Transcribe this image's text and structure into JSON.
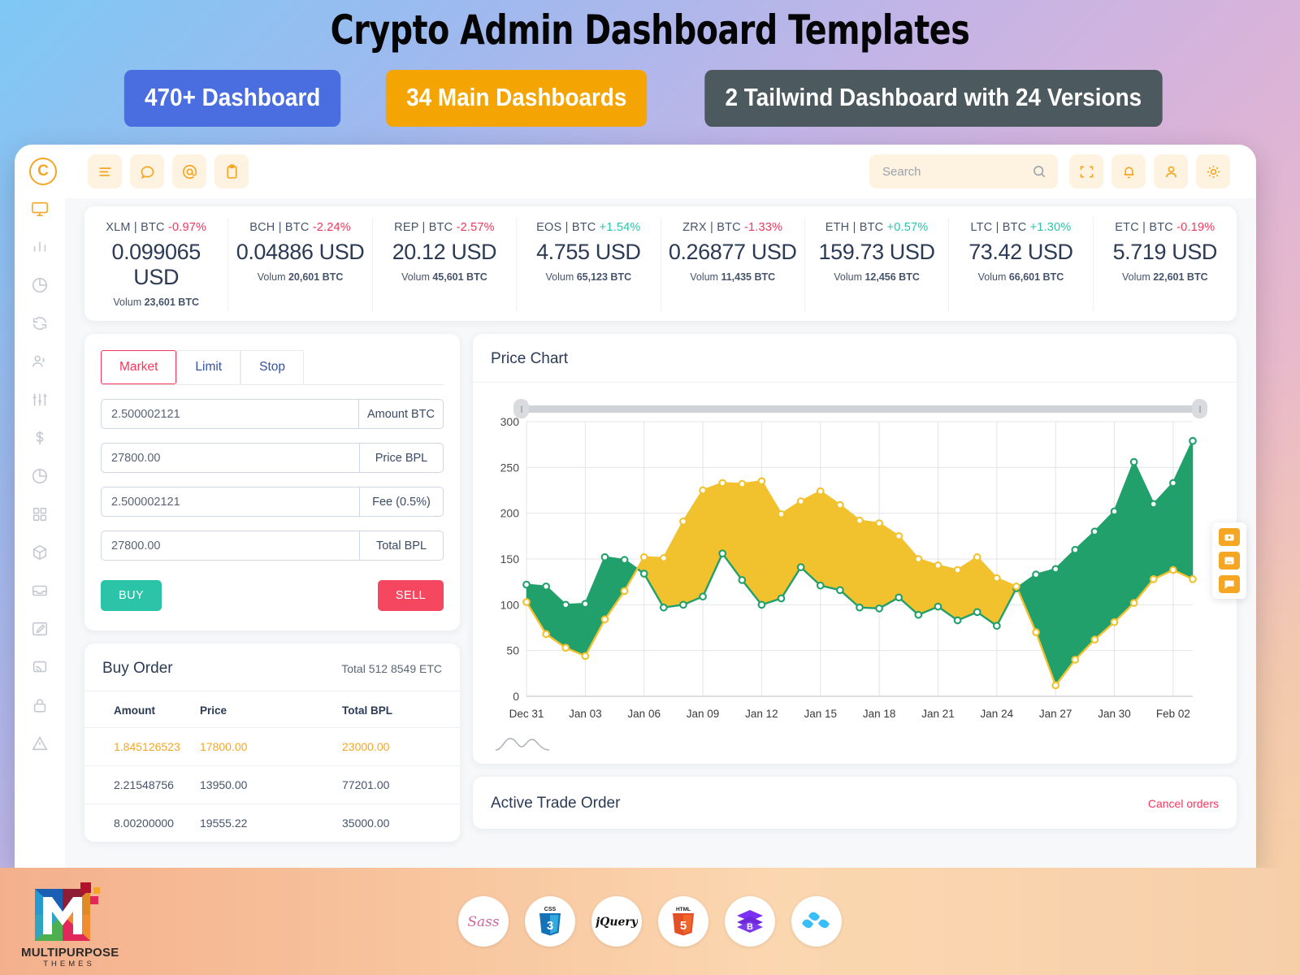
{
  "promo": {
    "title": "Crypto Admin Dashboard Templates",
    "badges": [
      "470+ Dashboard",
      "34 Main Dashboards",
      "2 Tailwind Dashboard with 24 Versions"
    ]
  },
  "topbar": {
    "logo_text": "C",
    "icons": [
      "menu-icon",
      "chat-icon",
      "at-icon",
      "clipboard-icon"
    ],
    "search_placeholder": "Search",
    "search_value": "",
    "right_icons": [
      "fullscreen-icon",
      "bell-icon",
      "user-icon",
      "gear-icon"
    ]
  },
  "sidebar": {
    "items": [
      {
        "icon": "monitor-icon",
        "active": true
      },
      {
        "icon": "bar-chart-icon",
        "active": false
      },
      {
        "icon": "pie-chart-icon",
        "active": false
      },
      {
        "icon": "refresh-icon",
        "active": false
      },
      {
        "icon": "users-icon",
        "active": false
      },
      {
        "icon": "sliders-icon",
        "active": false
      },
      {
        "icon": "dollar-icon",
        "active": false
      },
      {
        "icon": "pie-chart-2-icon",
        "active": false
      },
      {
        "icon": "grid-icon",
        "active": false
      },
      {
        "icon": "box-icon",
        "active": false
      },
      {
        "icon": "inbox-icon",
        "active": false
      },
      {
        "icon": "edit-icon",
        "active": false
      },
      {
        "icon": "cast-icon",
        "active": false
      },
      {
        "icon": "lock-icon",
        "active": false
      },
      {
        "icon": "alert-icon",
        "active": false
      }
    ]
  },
  "ticker": [
    {
      "pair": "XLM | BTC",
      "change": "-0.97%",
      "dir": "down",
      "price": "0.099065 USD",
      "vol_label": "Volum",
      "vol": "23,601 BTC"
    },
    {
      "pair": "BCH | BTC",
      "change": "-2.24%",
      "dir": "down",
      "price": "0.04886 USD",
      "vol_label": "Volum",
      "vol": "20,601 BTC"
    },
    {
      "pair": "REP | BTC",
      "change": "-2.57%",
      "dir": "down",
      "price": "20.12 USD",
      "vol_label": "Volum",
      "vol": "45,601 BTC"
    },
    {
      "pair": "EOS | BTC",
      "change": "+1.54%",
      "dir": "up",
      "price": "4.755 USD",
      "vol_label": "Volum",
      "vol": "65,123 BTC"
    },
    {
      "pair": "ZRX | BTC",
      "change": "-1.33%",
      "dir": "down",
      "price": "0.26877 USD",
      "vol_label": "Volum",
      "vol": "11,435 BTC"
    },
    {
      "pair": "ETH | BTC",
      "change": "+0.57%",
      "dir": "up",
      "price": "159.73 USD",
      "vol_label": "Volum",
      "vol": "12,456 BTC"
    },
    {
      "pair": "LTC | BTC",
      "change": "+1.30%",
      "dir": "up",
      "price": "73.42 USD",
      "vol_label": "Volum",
      "vol": "66,601 BTC"
    },
    {
      "pair": "ETC | BTC",
      "change": "-0.19%",
      "dir": "down",
      "price": "5.719 USD",
      "vol_label": "Volum",
      "vol": "22,601 BTC"
    }
  ],
  "order_form": {
    "tabs": [
      {
        "label": "Market",
        "active": true
      },
      {
        "label": "Limit",
        "active": false
      },
      {
        "label": "Stop",
        "active": false
      }
    ],
    "fields": [
      {
        "value": "2.500002121",
        "suffix": "Amount BTC"
      },
      {
        "value": "27800.00",
        "suffix": "Price BPL"
      },
      {
        "value": "2.500002121",
        "suffix": "Fee (0.5%)"
      },
      {
        "value": "27800.00",
        "suffix": "Total BPL"
      }
    ],
    "buy_label": "BUY",
    "sell_label": "SELL"
  },
  "buy_order": {
    "title": "Buy Order",
    "total": "Total 512 8549 ETC",
    "columns": [
      "Amount",
      "Price",
      "Total BPL"
    ],
    "rows": [
      {
        "amount": "1.845126523",
        "price": "17800.00",
        "total": "23000.00",
        "highlight": true
      },
      {
        "amount": "2.21548756",
        "price": "13950.00",
        "total": "77201.00",
        "highlight": false
      },
      {
        "amount": "8.00200000",
        "price": "19555.22",
        "total": "35000.00",
        "highlight": false
      }
    ]
  },
  "price_chart": {
    "title": "Price Chart",
    "slider_left": "0%",
    "slider_right": "100%"
  },
  "active_trade": {
    "title": "Active Trade Order",
    "cancel_label": "Cancel orders"
  },
  "float_buttons": [
    "camera-icon",
    "image-icon",
    "chat-bubble-icon"
  ],
  "footer": {
    "brand_name": "MULTIPURPOSE",
    "brand_sub": "THEMES",
    "tech": [
      "Sass",
      "CSS3",
      "jQuery",
      "HTML5",
      "Bootstrap",
      "Tailwind"
    ]
  },
  "colors": {
    "accent_orange": "#f5a623",
    "green": "#21a06b",
    "yellow": "#f2c12e",
    "red": "#f5365c",
    "teal": "#2bc4a8",
    "blue_badge": "#4a6ee0",
    "dark_badge": "#4c5a60"
  },
  "chart_data": {
    "type": "area",
    "title": "Price Chart",
    "xlabel": "",
    "ylabel": "",
    "ylim": [
      0,
      300
    ],
    "yticks": [
      0,
      50,
      100,
      150,
      200,
      250,
      300
    ],
    "grid": true,
    "legend": "none",
    "tick_labels": [
      "Dec 31",
      "Jan 03",
      "Jan 06",
      "Jan 09",
      "Jan 12",
      "Jan 15",
      "Jan 18",
      "Jan 21",
      "Jan 24",
      "Jan 27",
      "Jan 30",
      "Feb 02"
    ],
    "x": [
      0,
      1,
      2,
      3,
      4,
      5,
      6,
      7,
      8,
      9,
      10,
      11,
      12,
      13,
      14,
      15,
      16,
      17,
      18,
      19,
      20,
      21,
      22,
      23,
      24,
      25,
      26,
      27,
      28,
      29,
      30,
      31,
      32,
      33,
      34
    ],
    "series": [
      {
        "name": "Green",
        "color": "#21a06b",
        "values": [
          122,
          120,
          100,
          101,
          152,
          149,
          134,
          97,
          100,
          109,
          156,
          127,
          100,
          107,
          141,
          121,
          116,
          97,
          96,
          108,
          89,
          98,
          83,
          92,
          77,
          118,
          133,
          139,
          160,
          180,
          202,
          256,
          210,
          233,
          279
        ]
      },
      {
        "name": "Yellow",
        "color": "#f2c12e",
        "values": [
          103,
          68,
          53,
          44,
          84,
          115,
          152,
          151,
          191,
          225,
          233,
          232,
          235,
          199,
          213,
          224,
          209,
          192,
          189,
          175,
          150,
          143,
          138,
          152,
          129,
          120,
          70,
          12,
          40,
          62,
          81,
          102,
          128,
          138,
          128
        ]
      }
    ]
  }
}
